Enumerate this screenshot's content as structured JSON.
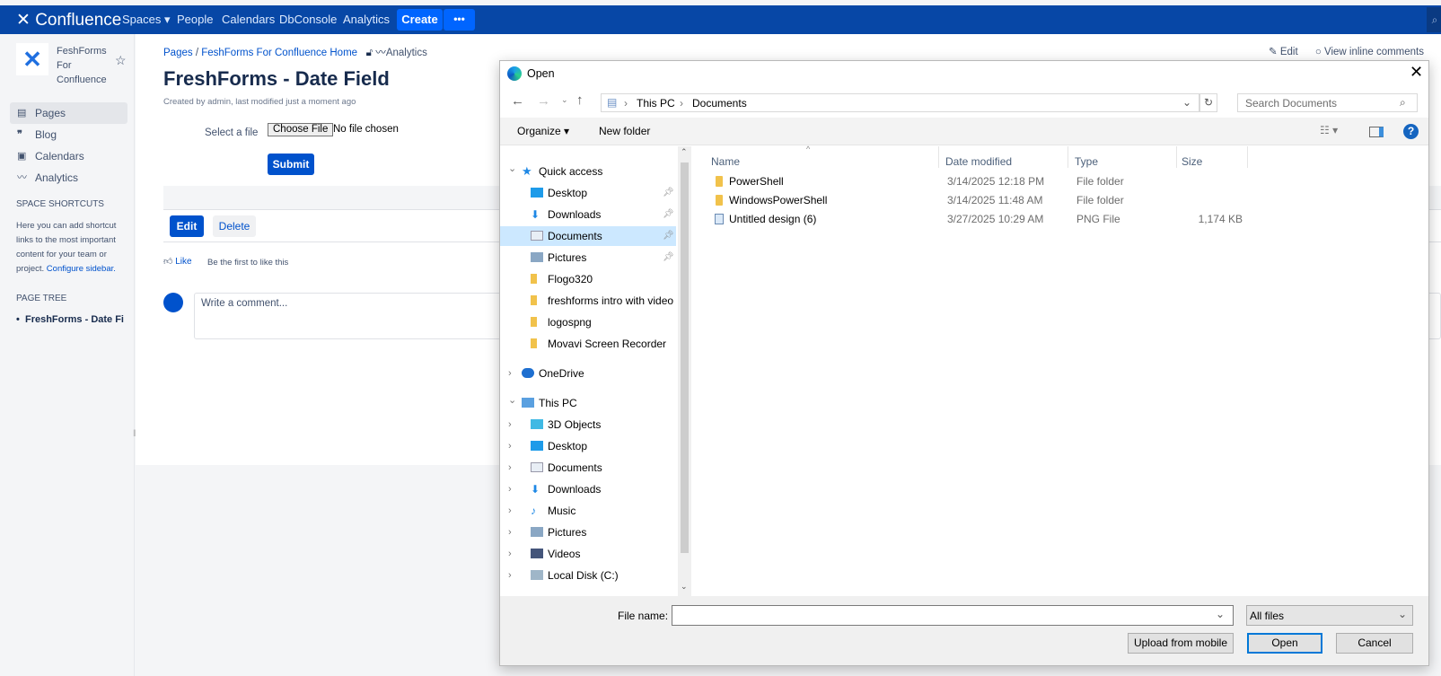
{
  "topbar": {
    "logo": "Confluence",
    "nav": [
      "Spaces",
      "People",
      "Calendars",
      "DbConsole",
      "Analytics"
    ],
    "create": "Create",
    "more": "•••"
  },
  "space": {
    "name_lines": [
      "FeshForms",
      "For",
      "Confluence"
    ]
  },
  "sidebar": {
    "items": [
      {
        "label": "Pages",
        "icon": "page-icon",
        "active": true
      },
      {
        "label": "Blog",
        "icon": "quote-icon"
      },
      {
        "label": "Calendars",
        "icon": "calendar-icon"
      },
      {
        "label": "Analytics",
        "icon": "analytics-icon"
      }
    ],
    "shortcuts_title": "SPACE SHORTCUTS",
    "shortcuts_text": "Here you can add shortcut links to the most important content for your team or project.",
    "configure": "Configure sidebar.",
    "tree_title": "PAGE TREE",
    "tree_item": "FreshForms - Date Fi"
  },
  "page": {
    "breadcrumb": [
      "Pages",
      "FeshForms For Confluence Home"
    ],
    "analytics": "Analytics",
    "title": "FreshForms - Date Field",
    "byline": "Created by admin, last modified just a moment ago",
    "select_label": "Select a file",
    "choose_file": "Choose File",
    "no_file": "No file chosen",
    "submit": "Submit",
    "edit": "Edit",
    "delete": "Delete",
    "like": "Like",
    "like_text": "Be the first to like this",
    "comment_placeholder": "Write a comment...",
    "edit_link": "Edit",
    "view_inline": "View inline comments"
  },
  "dialog": {
    "title": "Open",
    "path": [
      "This PC",
      "Documents"
    ],
    "search_placeholder": "Search Documents",
    "organize": "Organize",
    "new_folder": "New folder",
    "nav": [
      {
        "label": "Quick access",
        "level": 0,
        "expanded": true,
        "icon": "star-icon"
      },
      {
        "label": "Desktop",
        "level": 1,
        "pinned": true,
        "icon": "desktop-icon"
      },
      {
        "label": "Downloads",
        "level": 1,
        "pinned": true,
        "icon": "download-icon"
      },
      {
        "label": "Documents",
        "level": 1,
        "pinned": true,
        "selected": true,
        "icon": "document-icon"
      },
      {
        "label": "Pictures",
        "level": 1,
        "pinned": true,
        "icon": "pictures-icon"
      },
      {
        "label": "Flogo320",
        "level": 1,
        "icon": "folder-icon"
      },
      {
        "label": "freshforms intro with video",
        "level": 1,
        "icon": "folder-icon"
      },
      {
        "label": "logospng",
        "level": 1,
        "icon": "folder-icon"
      },
      {
        "label": "Movavi Screen Recorder",
        "level": 1,
        "icon": "folder-icon"
      },
      {
        "label": "OneDrive",
        "level": 0,
        "icon": "cloud-icon"
      },
      {
        "label": "This PC",
        "level": 0,
        "expanded": true,
        "icon": "pc-icon"
      },
      {
        "label": "3D Objects",
        "level": 1,
        "icon": "cube-icon"
      },
      {
        "label": "Desktop",
        "level": 1,
        "icon": "desktop-icon"
      },
      {
        "label": "Documents",
        "level": 1,
        "icon": "document-icon"
      },
      {
        "label": "Downloads",
        "level": 1,
        "icon": "download-icon"
      },
      {
        "label": "Music",
        "level": 1,
        "icon": "music-icon"
      },
      {
        "label": "Pictures",
        "level": 1,
        "icon": "pictures-icon"
      },
      {
        "label": "Videos",
        "level": 1,
        "icon": "videos-icon"
      },
      {
        "label": "Local Disk (C:)",
        "level": 1,
        "icon": "disk-icon"
      }
    ],
    "columns": [
      "Name",
      "Date modified",
      "Type",
      "Size"
    ],
    "files": [
      {
        "name": "PowerShell",
        "date": "3/14/2025 12:18 PM",
        "type": "File folder",
        "size": ""
      },
      {
        "name": "WindowsPowerShell",
        "date": "3/14/2025 11:48 AM",
        "type": "File folder",
        "size": ""
      },
      {
        "name": "Untitled design (6)",
        "date": "3/27/2025 10:29 AM",
        "type": "PNG File",
        "size": "1,174 KB"
      }
    ],
    "file_name_label": "File name:",
    "file_name_value": "",
    "filter": "All files",
    "upload": "Upload from mobile",
    "open": "Open",
    "cancel": "Cancel"
  },
  "colors": {
    "topbar": "#0747a6",
    "accent": "#0052cc",
    "selected": "#cce8ff"
  }
}
